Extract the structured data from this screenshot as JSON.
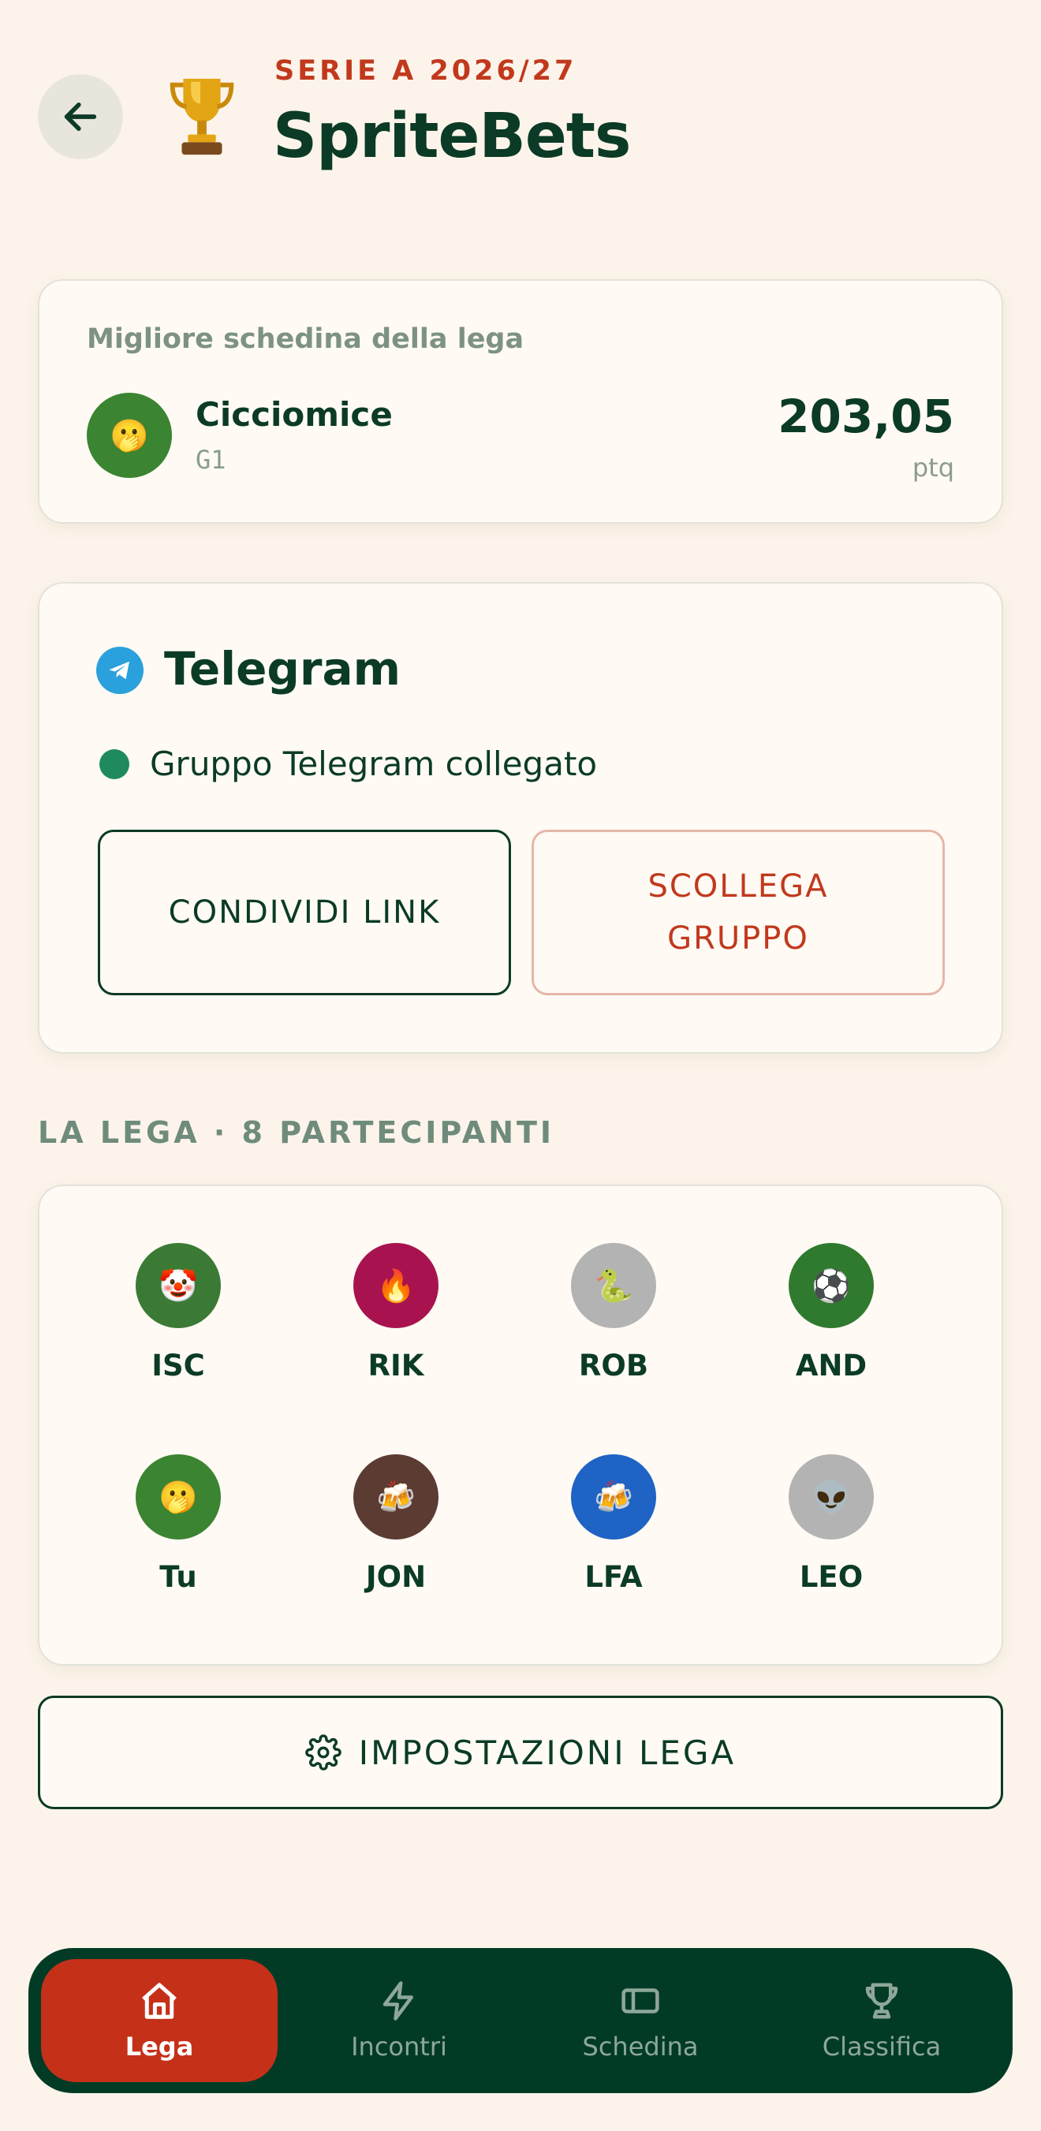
{
  "header": {
    "season": "SERIE A 2026/27",
    "title": "SpriteBets"
  },
  "best_ticket": {
    "label": "Migliore schedina della lega",
    "name": "Cicciomice",
    "sub": "G1",
    "score": "203,05",
    "unit": "ptq",
    "avatar_emoji": "🫢"
  },
  "telegram": {
    "title": "Telegram",
    "status": "Gruppo Telegram collegato",
    "share_label": "CONDIVIDI LINK",
    "unlink_label": "SCOLLEGA GRUPPO"
  },
  "league": {
    "section_title": "LA LEGA · 8 PARTECIPANTI",
    "members": [
      {
        "name": "ISC",
        "emoji": "🤡",
        "color": "#3b7a35"
      },
      {
        "name": "RIK",
        "emoji": "🔥",
        "color": "#a8134f"
      },
      {
        "name": "ROB",
        "emoji": "🐍",
        "color": "#b3b3b3"
      },
      {
        "name": "AND",
        "emoji": "⚽",
        "color": "#2f7a2e"
      },
      {
        "name": "Tu",
        "emoji": "🫢",
        "color": "#3b8431"
      },
      {
        "name": "JON",
        "emoji": "🍻",
        "color": "#5b3b32"
      },
      {
        "name": "LFA",
        "emoji": "🍻",
        "color": "#1f63c4"
      },
      {
        "name": "LEO",
        "emoji": "👽",
        "color": "#b3b3b3"
      }
    ]
  },
  "settings_label": "IMPOSTAZIONI LEGA",
  "nav": {
    "items": [
      {
        "label": "Lega",
        "icon": "home-icon"
      },
      {
        "label": "Incontri",
        "icon": "bolt-icon"
      },
      {
        "label": "Schedina",
        "icon": "ticket-icon"
      },
      {
        "label": "Classifica",
        "icon": "trophy-icon"
      }
    ],
    "active": "Lega"
  },
  "colors": {
    "background": "#fcf4ea",
    "primary": "#0b3b26",
    "accent": "#c1391d",
    "nav_bg": "#013b26",
    "telegram": "#2aa1dc"
  }
}
